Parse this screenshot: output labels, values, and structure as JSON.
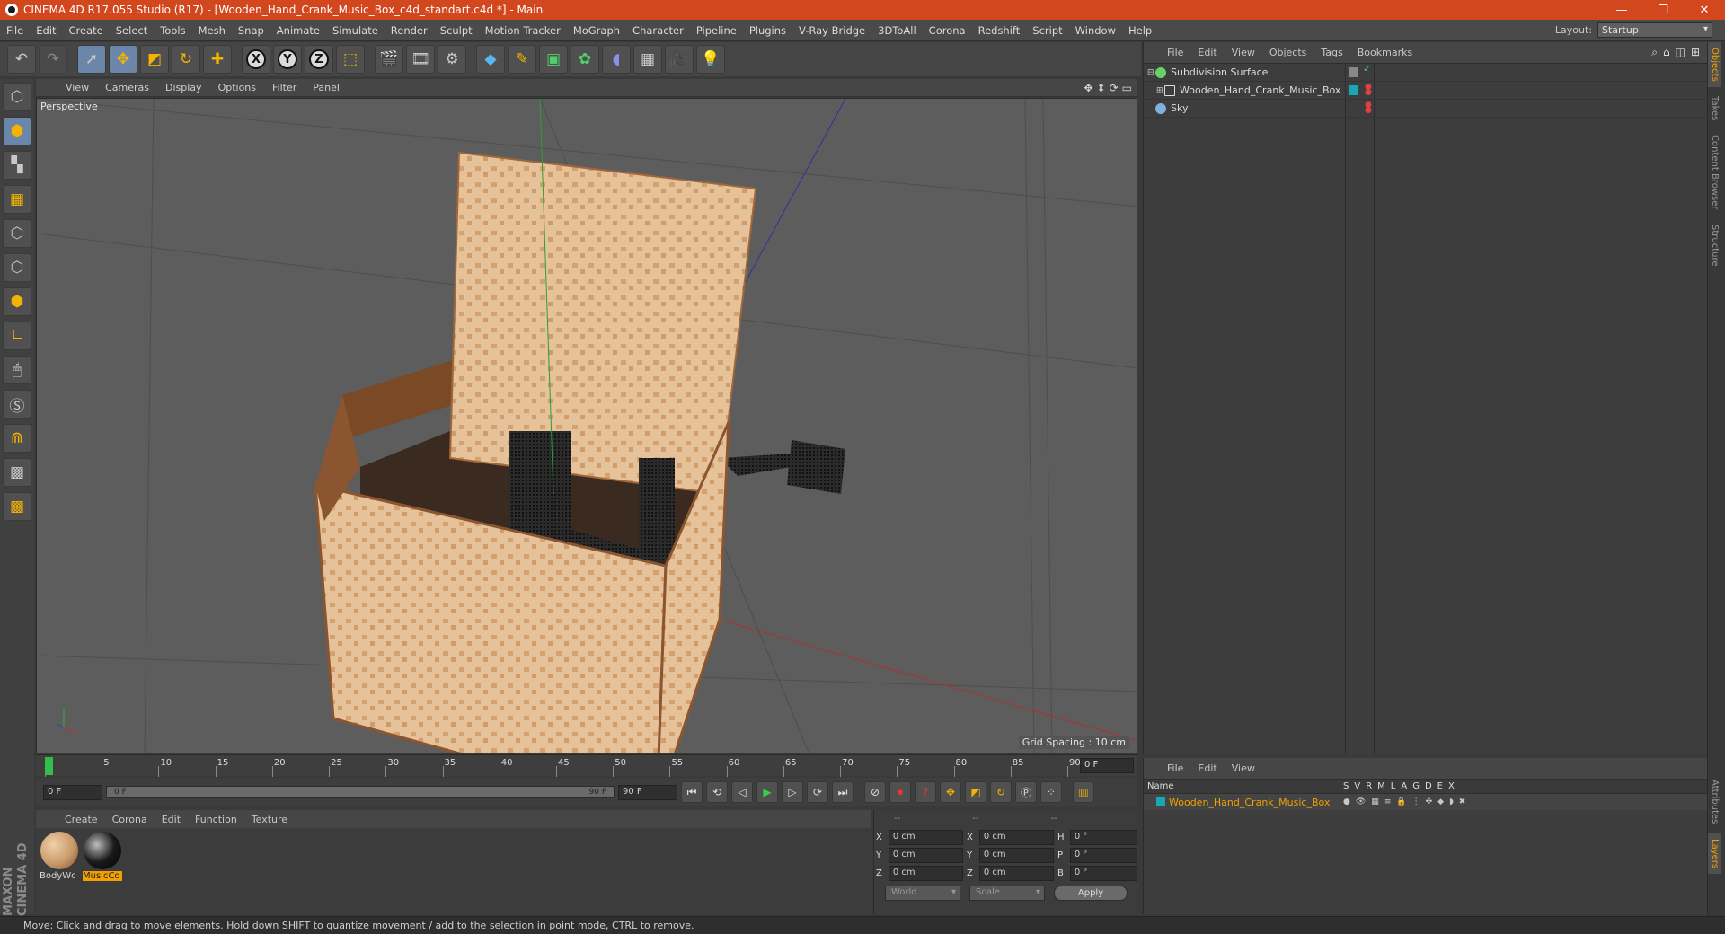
{
  "window": {
    "title": "CINEMA 4D R17.055 Studio (R17) - [Wooden_Hand_Crank_Music_Box_c4d_standart.c4d *] - Main",
    "min_icon": "minimize-icon",
    "max_icon": "restore-icon",
    "close_icon": "close-icon"
  },
  "menu": {
    "items": [
      "File",
      "Edit",
      "Create",
      "Select",
      "Tools",
      "Mesh",
      "Snap",
      "Animate",
      "Simulate",
      "Render",
      "Sculpt",
      "Motion Tracker",
      "MoGraph",
      "Character",
      "Pipeline",
      "Plugins",
      "V-Ray Bridge",
      "3DToAll",
      "Corona",
      "Redshift",
      "Script",
      "Window",
      "Help"
    ],
    "layout_label": "Layout:",
    "layout_value": "Startup"
  },
  "toolbar": {
    "icons": [
      "undo-icon",
      "redo-icon",
      "live-select-icon",
      "move-icon",
      "scale-icon",
      "rotate-icon",
      "move-add-icon",
      "x-axis-icon",
      "y-axis-icon",
      "z-axis-icon",
      "coordinate-system-icon",
      "render-view-icon",
      "render-picture-viewer-icon",
      "render-settings-icon",
      "cube-icon",
      "spline-pen-icon",
      "subdivision-icon",
      "array-icon",
      "deformer-icon",
      "floor-icon",
      "camera-icon",
      "light-icon"
    ],
    "axis_x": "X",
    "axis_y": "Y",
    "axis_z": "Z"
  },
  "left_tools": [
    "make-editable-icon",
    "model-mode-icon",
    "texture-mode-icon",
    "workplane-icon",
    "points-mode-icon",
    "edges-mode-icon",
    "polygons-mode-icon",
    "axis-mode-icon",
    "tweak-icon",
    "snap-icon",
    "magnet-icon",
    "workplane-lock-icon",
    "solo-icon"
  ],
  "branding": "MAXON CINEMA 4D",
  "viewport": {
    "menu": [
      "View",
      "Cameras",
      "Display",
      "Options",
      "Filter",
      "Panel"
    ],
    "label": "Perspective",
    "grid_spacing": "Grid Spacing : 10 cm"
  },
  "timeline": {
    "ticks": [
      "0",
      "5",
      "10",
      "15",
      "20",
      "25",
      "30",
      "35",
      "40",
      "45",
      "50",
      "55",
      "60",
      "65",
      "70",
      "75",
      "80",
      "85",
      "90"
    ],
    "end_frame": "0 F"
  },
  "transport": {
    "start": "0 F",
    "range_start": "0 F",
    "range_end": "90 F",
    "end": "90 F"
  },
  "materials": {
    "menu": [
      "Create",
      "Corona",
      "Edit",
      "Function",
      "Texture"
    ],
    "items": [
      {
        "label": "BodyWc",
        "color": "#c99a6a"
      },
      {
        "label": "MusicCo",
        "color": "#1a1a1a"
      }
    ]
  },
  "coordinates": {
    "headers": [
      "--",
      "--",
      "--"
    ],
    "rows": [
      {
        "a": "X",
        "av": "0 cm",
        "b": "X",
        "bv": "0 cm",
        "c": "H",
        "cv": "0 °"
      },
      {
        "a": "Y",
        "av": "0 cm",
        "b": "Y",
        "bv": "0 cm",
        "c": "P",
        "cv": "0 °"
      },
      {
        "a": "Z",
        "av": "0 cm",
        "b": "Z",
        "bv": "0 cm",
        "c": "B",
        "cv": "0 °"
      }
    ],
    "mode": "World",
    "size_mode": "Scale",
    "apply": "Apply"
  },
  "objects": {
    "menu": [
      "File",
      "Edit",
      "View",
      "Objects",
      "Tags",
      "Bookmarks"
    ],
    "items": [
      {
        "name": "Subdivision Surface",
        "icon_color": "#6ad06a",
        "indent": 0
      },
      {
        "name": "Wooden_Hand_Crank_Music_Box",
        "icon_color": "#d8d8d8",
        "indent": 1
      },
      {
        "name": "Sky",
        "icon_color": "#7fb0e0",
        "indent": 0
      }
    ]
  },
  "layers": {
    "menu": [
      "File",
      "Edit",
      "View"
    ],
    "name_col": "Name",
    "cols": [
      "S",
      "V",
      "R",
      "M",
      "L",
      "A",
      "G",
      "D",
      "E",
      "X"
    ],
    "rows": [
      {
        "name": "Wooden_Hand_Crank_Music_Box",
        "color": "#17a7b5"
      }
    ]
  },
  "right_tabs": [
    "Objects",
    "Takes",
    "Content Browser",
    "Structure",
    "Attributes",
    "Layers"
  ],
  "status": "Move: Click and drag to move elements. Hold down SHIFT to quantize movement / add to the selection in point mode, CTRL to remove.",
  "colors": {
    "titlebar": "#d3471f",
    "accent": "#f2a000",
    "layer": "#17a7b5"
  }
}
